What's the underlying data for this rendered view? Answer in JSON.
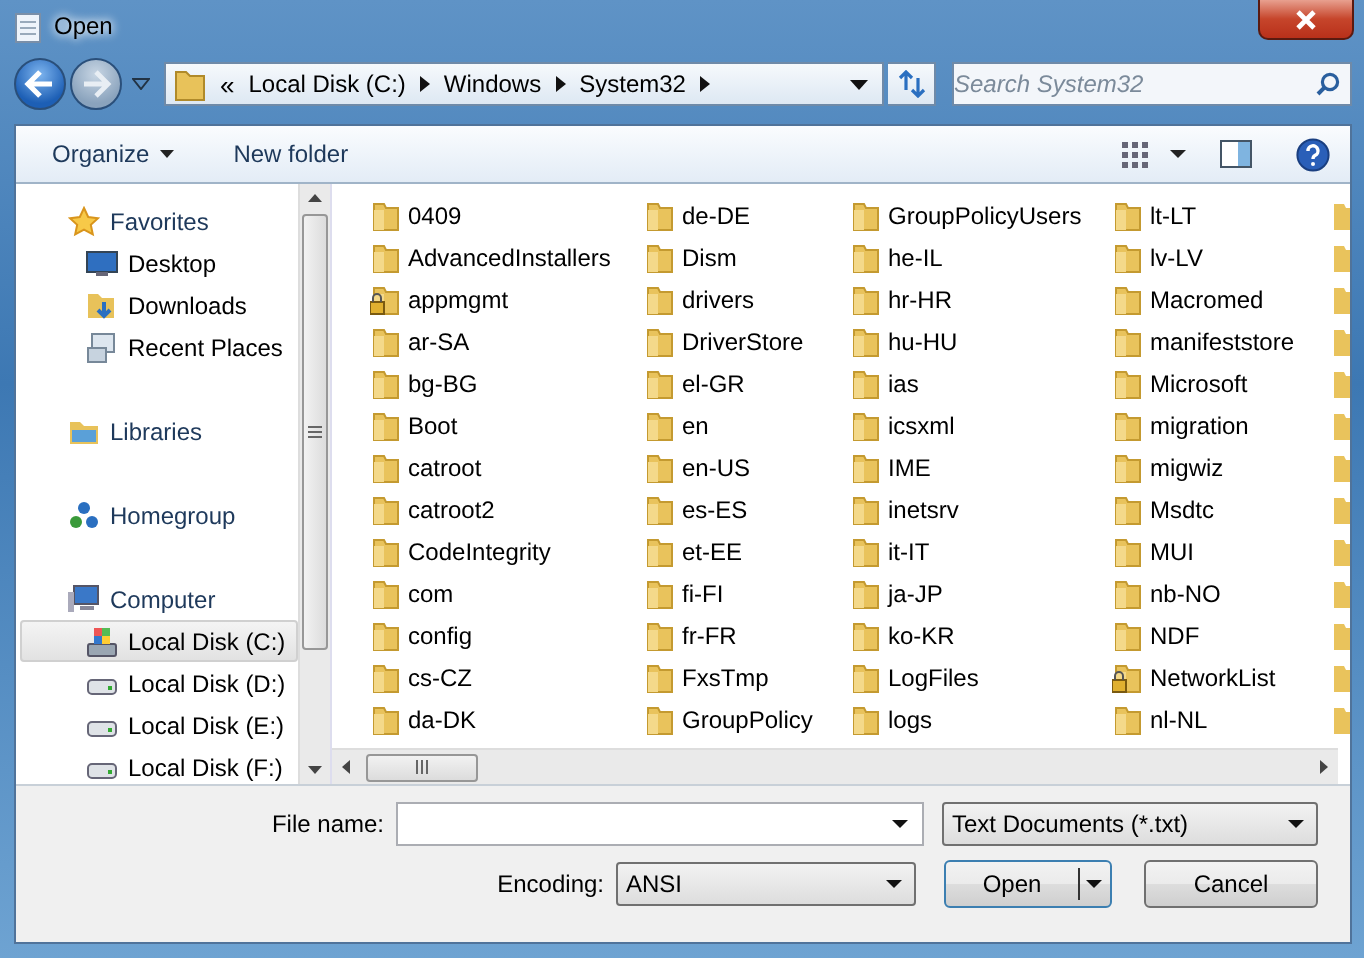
{
  "window": {
    "title": "Open"
  },
  "address": {
    "overflow": "«",
    "crumbs": [
      "Local Disk (C:)",
      "Windows",
      "System32"
    ]
  },
  "search": {
    "placeholder": "Search System32"
  },
  "toolbar": {
    "organize": "Organize",
    "new_folder": "New folder"
  },
  "sidebar": {
    "groups": [
      {
        "label": "Favorites",
        "children": [
          {
            "label": "Desktop",
            "selected": false
          },
          {
            "label": "Downloads",
            "selected": false
          },
          {
            "label": "Recent Places",
            "selected": false
          }
        ]
      },
      {
        "label": "Libraries"
      },
      {
        "label": "Homegroup"
      },
      {
        "label": "Computer",
        "children": [
          {
            "label": "Local Disk (C:)",
            "selected": true
          },
          {
            "label": "Local Disk (D:)",
            "selected": false
          },
          {
            "label": "Local Disk (E:)",
            "selected": false
          },
          {
            "label": "Local Disk (F:)",
            "selected": false
          }
        ]
      }
    ]
  },
  "folders": [
    [
      {
        "name": "0409",
        "locked": false
      },
      {
        "name": "AdvancedInstallers",
        "locked": false
      },
      {
        "name": "appmgmt",
        "locked": true
      },
      {
        "name": "ar-SA",
        "locked": false
      },
      {
        "name": "bg-BG",
        "locked": false
      },
      {
        "name": "Boot",
        "locked": false
      },
      {
        "name": "catroot",
        "locked": false
      },
      {
        "name": "catroot2",
        "locked": false
      },
      {
        "name": "CodeIntegrity",
        "locked": false
      },
      {
        "name": "com",
        "locked": false
      },
      {
        "name": "config",
        "locked": false
      },
      {
        "name": "cs-CZ",
        "locked": false
      },
      {
        "name": "da-DK",
        "locked": false
      }
    ],
    [
      {
        "name": "de-DE",
        "locked": false
      },
      {
        "name": "Dism",
        "locked": false
      },
      {
        "name": "drivers",
        "locked": false
      },
      {
        "name": "DriverStore",
        "locked": false
      },
      {
        "name": "el-GR",
        "locked": false
      },
      {
        "name": "en",
        "locked": false
      },
      {
        "name": "en-US",
        "locked": false
      },
      {
        "name": "es-ES",
        "locked": false
      },
      {
        "name": "et-EE",
        "locked": false
      },
      {
        "name": "fi-FI",
        "locked": false
      },
      {
        "name": "fr-FR",
        "locked": false
      },
      {
        "name": "FxsTmp",
        "locked": false
      },
      {
        "name": "GroupPolicy",
        "locked": false
      }
    ],
    [
      {
        "name": "GroupPolicyUsers",
        "locked": false
      },
      {
        "name": "he-IL",
        "locked": false
      },
      {
        "name": "hr-HR",
        "locked": false
      },
      {
        "name": "hu-HU",
        "locked": false
      },
      {
        "name": "ias",
        "locked": false
      },
      {
        "name": "icsxml",
        "locked": false
      },
      {
        "name": "IME",
        "locked": false
      },
      {
        "name": "inetsrv",
        "locked": false
      },
      {
        "name": "it-IT",
        "locked": false
      },
      {
        "name": "ja-JP",
        "locked": false
      },
      {
        "name": "ko-KR",
        "locked": false
      },
      {
        "name": "LogFiles",
        "locked": false
      },
      {
        "name": "logs",
        "locked": false
      }
    ],
    [
      {
        "name": "lt-LT",
        "locked": false
      },
      {
        "name": "lv-LV",
        "locked": false
      },
      {
        "name": "Macromed",
        "locked": false
      },
      {
        "name": "manifeststore",
        "locked": false
      },
      {
        "name": "Microsoft",
        "locked": false
      },
      {
        "name": "migration",
        "locked": false
      },
      {
        "name": "migwiz",
        "locked": false
      },
      {
        "name": "Msdtc",
        "locked": false
      },
      {
        "name": "MUI",
        "locked": false
      },
      {
        "name": "nb-NO",
        "locked": false
      },
      {
        "name": "NDF",
        "locked": false
      },
      {
        "name": "NetworkList",
        "locked": true
      },
      {
        "name": "nl-NL",
        "locked": false
      }
    ]
  ],
  "bottom": {
    "file_name_label": "File name:",
    "file_type": "Text Documents (*.txt)",
    "encoding_label": "Encoding:",
    "encoding": "ANSI",
    "open": "Open",
    "cancel": "Cancel"
  }
}
